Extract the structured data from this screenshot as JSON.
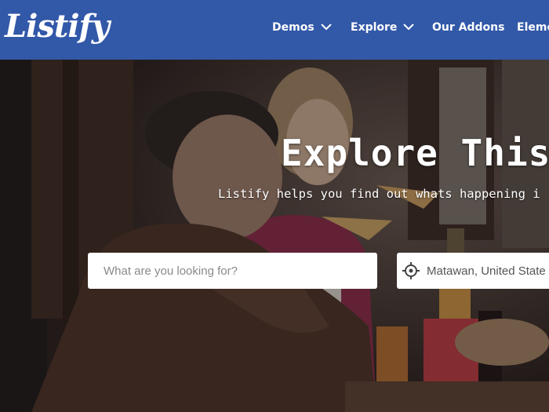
{
  "header": {
    "logo": "Listify",
    "nav": [
      {
        "label": "Demos",
        "has_dropdown": true
      },
      {
        "label": "Explore",
        "has_dropdown": true
      },
      {
        "label": "Our Addons",
        "has_dropdown": false
      },
      {
        "label": "Eleme",
        "has_dropdown": false
      }
    ]
  },
  "hero": {
    "title": "Explore This",
    "subtitle": "Listify helps you find out whats happening i",
    "search": {
      "placeholder": "What are you looking for?",
      "value": ""
    },
    "location": {
      "value": "Matawan, United State"
    }
  },
  "colors": {
    "header_bg": "#3258a8",
    "text": "#ffffff"
  },
  "icons": {
    "dropdown": "chevron-down-icon",
    "locate": "crosshair-icon"
  }
}
